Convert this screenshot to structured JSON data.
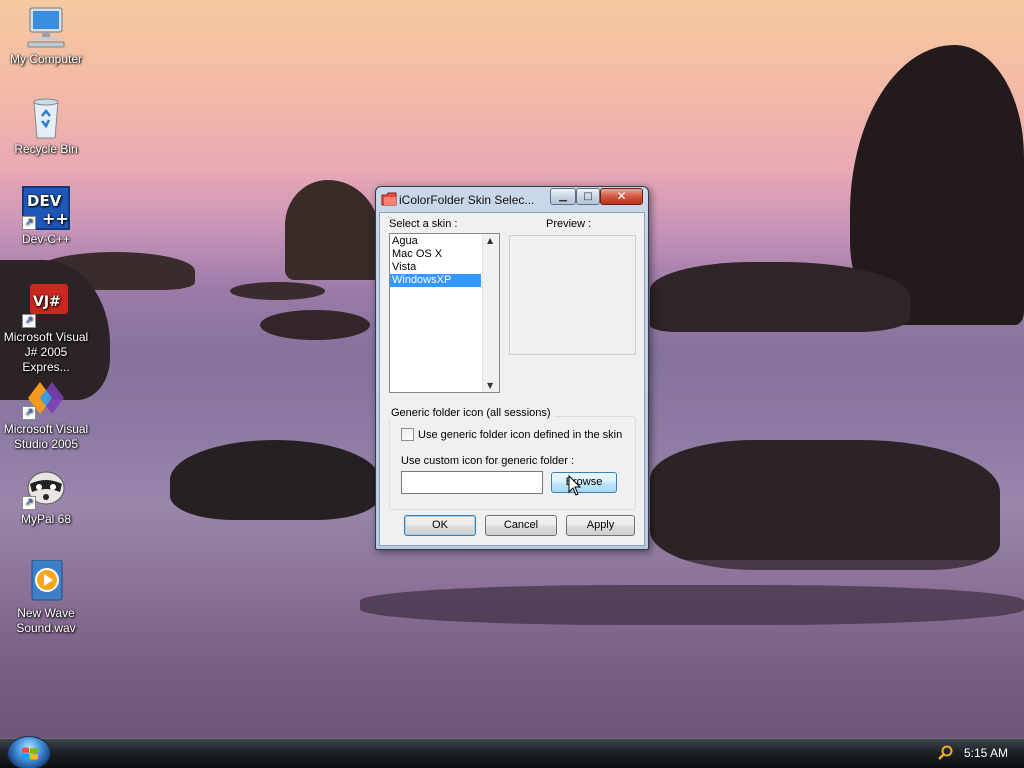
{
  "desktop": {
    "icons": [
      {
        "label": "My Computer",
        "icon": "computer-icon"
      },
      {
        "label": "Recycle Bin",
        "icon": "recycle-bin-icon"
      },
      {
        "label": "Dev-C++",
        "icon": "dev-cpp-icon",
        "badge": "DEV"
      },
      {
        "label": "Microsoft Visual J# 2005 Expres...",
        "icon": "visual-jsharp-icon",
        "badge": "VJ#"
      },
      {
        "label": "Microsoft Visual Studio 2005",
        "icon": "visual-studio-icon"
      },
      {
        "label": "MyPal 68",
        "icon": "mypal-raccoon-icon"
      },
      {
        "label": "New Wave Sound.wav",
        "icon": "wave-sound-icon"
      }
    ]
  },
  "dialog": {
    "title": "iColorFolder Skin Selec...",
    "select_skin_label": "Select a skin :",
    "preview_label": "Preview :",
    "skins": [
      "Agua",
      "Mac OS X",
      "Vista",
      "WindowsXP"
    ],
    "selected_skin": "WindowsXP",
    "generic_group_title": "Generic folder icon (all sessions)",
    "use_generic_checkbox_label": "Use generic folder icon defined in the skin",
    "use_generic_checked": false,
    "custom_icon_label": "Use custom icon for generic folder :",
    "custom_icon_value": "",
    "browse_label": "Browse",
    "ok_label": "OK",
    "cancel_label": "Cancel",
    "apply_label": "Apply",
    "controls": {
      "minimize": "minimize-icon",
      "maximize": "maximize-icon",
      "close": "close-icon"
    }
  },
  "taskbar": {
    "clock": "5:15 AM",
    "start_icon": "windows-logo-icon",
    "tray_icon": "search-icon"
  },
  "colors": {
    "selection": "#3399ff",
    "taskbar": "#1d2227",
    "close_button": "#c8452c"
  }
}
